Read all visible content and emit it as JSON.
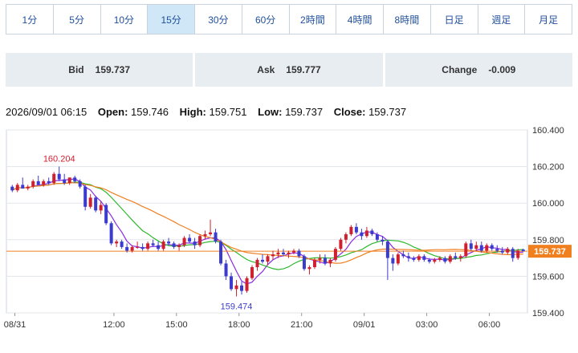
{
  "timeframes": [
    {
      "label": "1分",
      "active": false
    },
    {
      "label": "5分",
      "active": false
    },
    {
      "label": "10分",
      "active": false
    },
    {
      "label": "15分",
      "active": true
    },
    {
      "label": "30分",
      "active": false
    },
    {
      "label": "60分",
      "active": false
    },
    {
      "label": "2時間",
      "active": false
    },
    {
      "label": "4時間",
      "active": false
    },
    {
      "label": "8時間",
      "active": false
    },
    {
      "label": "日足",
      "active": false
    },
    {
      "label": "週足",
      "active": false
    },
    {
      "label": "月足",
      "active": false
    }
  ],
  "quotes": {
    "bid_label": "Bid",
    "bid_value": "159.737",
    "ask_label": "Ask",
    "ask_value": "159.777",
    "change_label": "Change",
    "change_value": "-0.009"
  },
  "ohlc": {
    "time": "2026/09/01 06:15",
    "open_label": "Open:",
    "open": "159.746",
    "high_label": "High:",
    "high": "159.751",
    "low_label": "Low:",
    "low": "159.737",
    "close_label": "Close:",
    "close": "159.737"
  },
  "colors": {
    "up": "#d02030",
    "down": "#3b3bd0",
    "ma_short": "#2eb82e",
    "ma_purple": "#8a2be2",
    "ma_long": "#f07f20",
    "price_tag": "#f07f20"
  },
  "chart_data": {
    "type": "candlestick",
    "ylim": [
      159.4,
      160.4
    ],
    "y_ticks": [
      "160.400",
      "160.200",
      "160.000",
      "159.800",
      "159.600",
      "159.400"
    ],
    "x_ticks": [
      "08/31",
      "12:00",
      "15:00",
      "18:00",
      "21:00",
      "09/01",
      "03:00",
      "06:00"
    ],
    "high_annotation": "160.204",
    "low_annotation": "159.474",
    "last_price": "159.737",
    "candles": [
      [
        160.09,
        160.1,
        160.06,
        160.07
      ],
      [
        160.07,
        160.11,
        160.06,
        160.1
      ],
      [
        160.1,
        160.14,
        160.08,
        160.08
      ],
      [
        160.08,
        160.1,
        160.07,
        160.09
      ],
      [
        160.09,
        160.13,
        160.08,
        160.12
      ],
      [
        160.12,
        160.15,
        160.1,
        160.1
      ],
      [
        160.1,
        160.13,
        160.09,
        160.12
      ],
      [
        160.12,
        160.14,
        160.1,
        160.11
      ],
      [
        160.11,
        160.17,
        160.1,
        160.16
      ],
      [
        160.16,
        160.2,
        160.12,
        160.13
      ],
      [
        160.13,
        160.16,
        160.1,
        160.11
      ],
      [
        160.11,
        160.14,
        160.1,
        160.14
      ],
      [
        160.14,
        160.15,
        160.11,
        160.12
      ],
      [
        160.12,
        160.13,
        160.08,
        160.09
      ],
      [
        160.09,
        160.1,
        159.96,
        159.98
      ],
      [
        159.98,
        160.05,
        159.97,
        160.03
      ],
      [
        160.03,
        160.04,
        159.95,
        159.96
      ],
      [
        159.96,
        160.01,
        159.94,
        159.99
      ],
      [
        159.99,
        160.0,
        159.88,
        159.89
      ],
      [
        159.89,
        159.9,
        159.77,
        159.78
      ],
      [
        159.78,
        159.8,
        159.76,
        159.79
      ],
      [
        159.79,
        159.8,
        159.75,
        159.76
      ],
      [
        159.76,
        159.78,
        159.73,
        159.74
      ],
      [
        159.74,
        159.77,
        159.73,
        159.76
      ],
      [
        159.76,
        159.79,
        159.75,
        159.76
      ],
      [
        159.76,
        159.78,
        159.74,
        159.75
      ],
      [
        159.75,
        159.79,
        159.74,
        159.78
      ],
      [
        159.78,
        159.8,
        159.76,
        159.77
      ],
      [
        159.77,
        159.79,
        159.74,
        159.75
      ],
      [
        159.75,
        159.8,
        159.74,
        159.79
      ],
      [
        159.79,
        159.81,
        159.77,
        159.78
      ],
      [
        159.78,
        159.79,
        159.75,
        159.76
      ],
      [
        159.76,
        159.78,
        159.74,
        159.77
      ],
      [
        159.77,
        159.82,
        159.76,
        159.81
      ],
      [
        159.81,
        159.83,
        159.78,
        159.79
      ],
      [
        159.79,
        159.81,
        159.75,
        159.77
      ],
      [
        159.77,
        159.83,
        159.76,
        159.82
      ],
      [
        159.82,
        159.85,
        159.8,
        159.83
      ],
      [
        159.83,
        159.91,
        159.82,
        159.84
      ],
      [
        159.84,
        159.86,
        159.78,
        159.79
      ],
      [
        159.79,
        159.8,
        159.66,
        159.67
      ],
      [
        159.67,
        159.69,
        159.58,
        159.6
      ],
      [
        159.6,
        159.62,
        159.52,
        159.53
      ],
      [
        159.53,
        159.58,
        159.49,
        159.55
      ],
      [
        159.55,
        159.57,
        159.5,
        159.52
      ],
      [
        159.52,
        159.6,
        159.51,
        159.59
      ],
      [
        159.59,
        159.66,
        159.58,
        159.65
      ],
      [
        159.65,
        159.7,
        159.63,
        159.69
      ],
      [
        159.69,
        159.72,
        159.67,
        159.68
      ],
      [
        159.68,
        159.72,
        159.66,
        159.71
      ],
      [
        159.71,
        159.74,
        159.69,
        159.72
      ],
      [
        159.72,
        159.75,
        159.7,
        159.73
      ],
      [
        159.73,
        159.75,
        159.71,
        159.72
      ],
      [
        159.72,
        159.74,
        159.7,
        159.73
      ],
      [
        159.73,
        159.75,
        159.72,
        159.74
      ],
      [
        159.74,
        159.75,
        159.7,
        159.71
      ],
      [
        159.71,
        159.72,
        159.63,
        159.64
      ],
      [
        159.64,
        159.66,
        159.61,
        159.65
      ],
      [
        159.65,
        159.7,
        159.64,
        159.69
      ],
      [
        159.69,
        159.72,
        159.67,
        159.7
      ],
      [
        159.7,
        159.72,
        159.66,
        159.67
      ],
      [
        159.67,
        159.7,
        159.65,
        159.69
      ],
      [
        159.69,
        159.76,
        159.68,
        159.75
      ],
      [
        159.75,
        159.81,
        159.74,
        159.8
      ],
      [
        159.8,
        159.84,
        159.78,
        159.83
      ],
      [
        159.83,
        159.88,
        159.82,
        159.87
      ],
      [
        159.87,
        159.89,
        159.83,
        159.84
      ],
      [
        159.84,
        159.86,
        159.8,
        159.82
      ],
      [
        159.82,
        159.87,
        159.81,
        159.85
      ],
      [
        159.85,
        159.86,
        159.82,
        159.83
      ],
      [
        159.83,
        159.84,
        159.79,
        159.8
      ],
      [
        159.8,
        159.82,
        159.77,
        159.79
      ],
      [
        159.79,
        159.8,
        159.58,
        159.7
      ],
      [
        159.7,
        159.72,
        159.63,
        159.67
      ],
      [
        159.67,
        159.73,
        159.66,
        159.72
      ],
      [
        159.72,
        159.74,
        159.7,
        159.71
      ],
      [
        159.71,
        159.73,
        159.68,
        159.7
      ],
      [
        159.7,
        159.71,
        159.68,
        159.69
      ],
      [
        159.69,
        159.72,
        159.68,
        159.71
      ],
      [
        159.71,
        159.72,
        159.68,
        159.69
      ],
      [
        159.69,
        159.7,
        159.67,
        159.68
      ],
      [
        159.68,
        159.7,
        159.67,
        159.69
      ],
      [
        159.69,
        159.71,
        159.68,
        159.7
      ],
      [
        159.7,
        159.71,
        159.67,
        159.68
      ],
      [
        159.68,
        159.72,
        159.67,
        159.71
      ],
      [
        159.71,
        159.73,
        159.69,
        159.7
      ],
      [
        159.7,
        159.72,
        159.68,
        159.71
      ],
      [
        159.71,
        159.79,
        159.7,
        159.78
      ],
      [
        159.78,
        159.8,
        159.74,
        159.75
      ],
      [
        159.75,
        159.79,
        159.74,
        159.77
      ],
      [
        159.77,
        159.79,
        159.73,
        159.74
      ],
      [
        159.74,
        159.78,
        159.73,
        159.77
      ],
      [
        159.77,
        159.78,
        159.74,
        159.75
      ],
      [
        159.75,
        159.77,
        159.73,
        159.74
      ],
      [
        159.74,
        159.76,
        159.72,
        159.73
      ],
      [
        159.73,
        159.76,
        159.72,
        159.75
      ],
      [
        159.75,
        159.76,
        159.68,
        159.7
      ],
      [
        159.7,
        159.75,
        159.69,
        159.74
      ],
      [
        159.746,
        159.751,
        159.737,
        159.737
      ]
    ]
  }
}
